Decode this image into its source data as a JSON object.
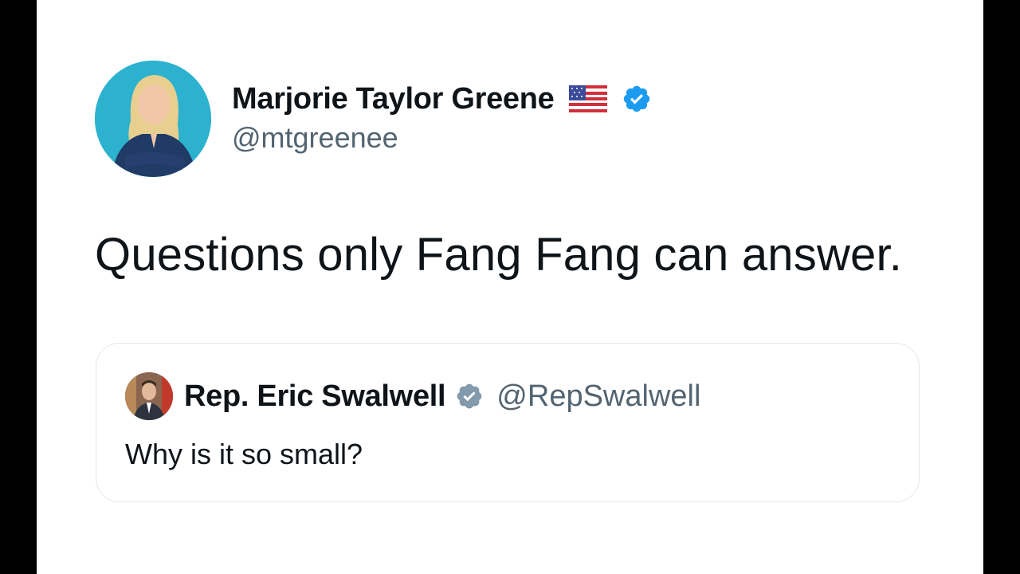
{
  "tweet": {
    "author": {
      "name": "Marjorie Taylor Greene",
      "handle": "@mtgreenee",
      "flag_icon": "us-flag-icon",
      "verified_icon": "verified-badge-icon",
      "verified_color": "#1d9bf0"
    },
    "text": "Questions only Fang Fang can answer."
  },
  "quoted_tweet": {
    "author": {
      "name": "Rep. Eric Swalwell",
      "handle": "@RepSwalwell",
      "verified_icon": "verified-badge-icon",
      "verified_color": "#829aab"
    },
    "text": "Why is it so small?"
  },
  "colors": {
    "background": "#ffffff",
    "frame": "#000000",
    "text_primary": "#0f1419",
    "text_secondary": "#536471",
    "border": "#e1e8ed"
  }
}
